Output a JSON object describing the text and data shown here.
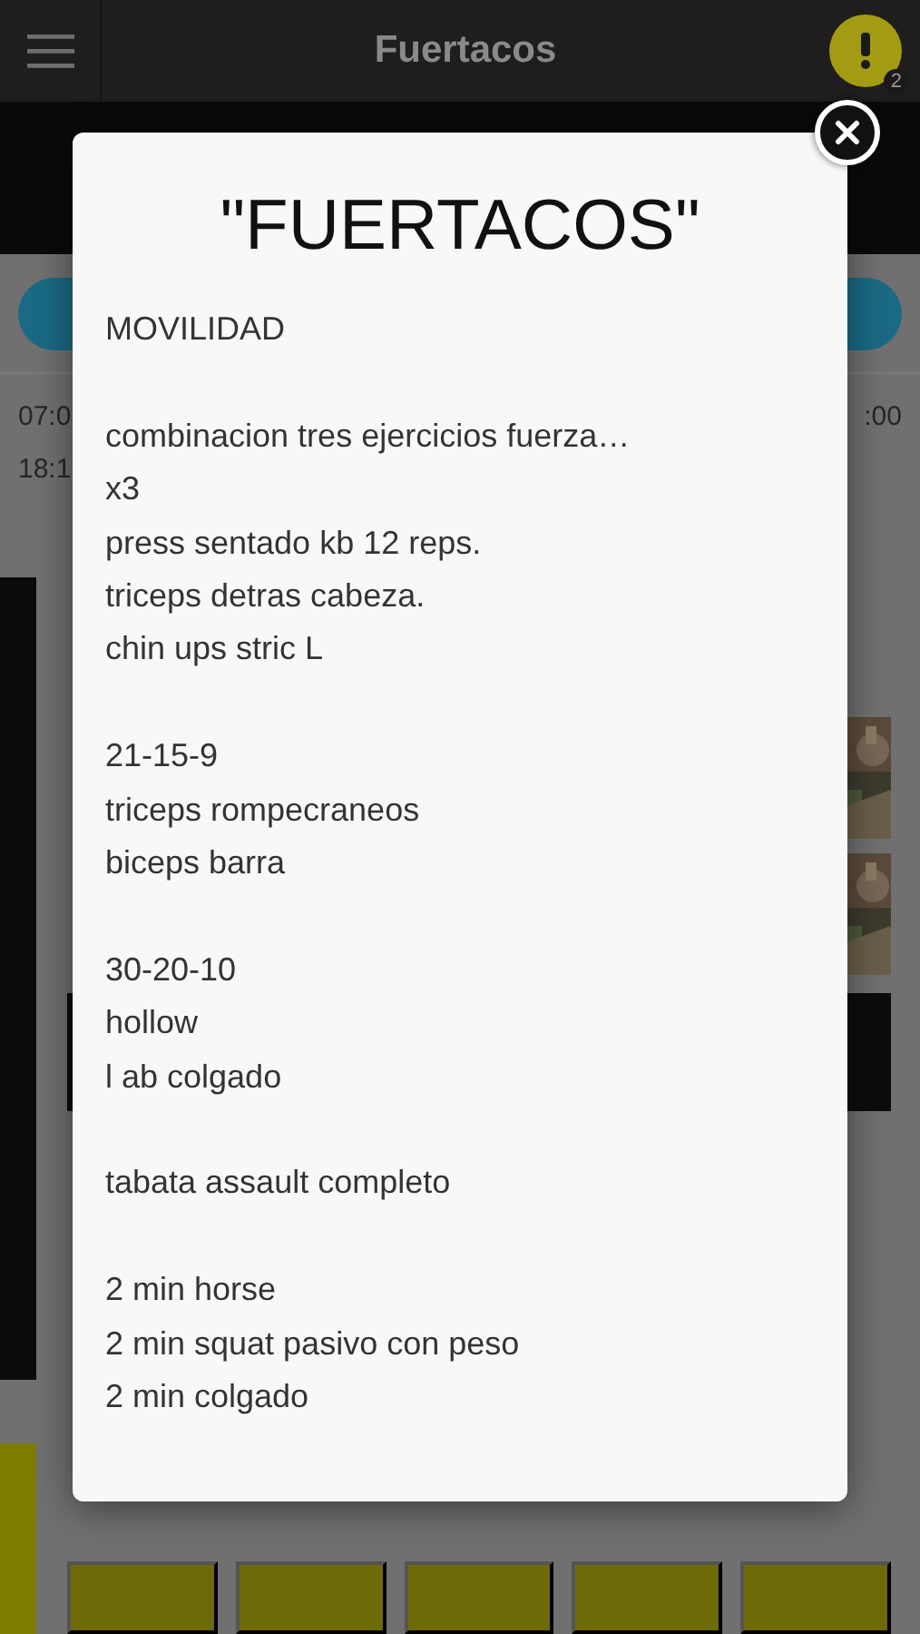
{
  "header": {
    "title": "Fuertacos",
    "alert_count": "2"
  },
  "background": {
    "times_left": [
      "07:0",
      "18:1"
    ],
    "time_right": ":00"
  },
  "modal": {
    "title": "\"FUERTACOS\"",
    "paragraphs": [
      [
        "MOVILIDAD"
      ],
      [
        "combinacion tres ejercicios fuerza…",
        "x3",
        "press sentado kb 12 reps.",
        "triceps detras cabeza.",
        "chin ups stric L"
      ],
      [
        "21-15-9",
        "triceps rompecraneos",
        "biceps barra"
      ],
      [
        "30-20-10",
        "hollow",
        "l ab colgado"
      ],
      [
        "tabata assault completo"
      ],
      [
        "2 min horse",
        "2 min squat pasivo con peso",
        "2 min colgado"
      ]
    ]
  }
}
